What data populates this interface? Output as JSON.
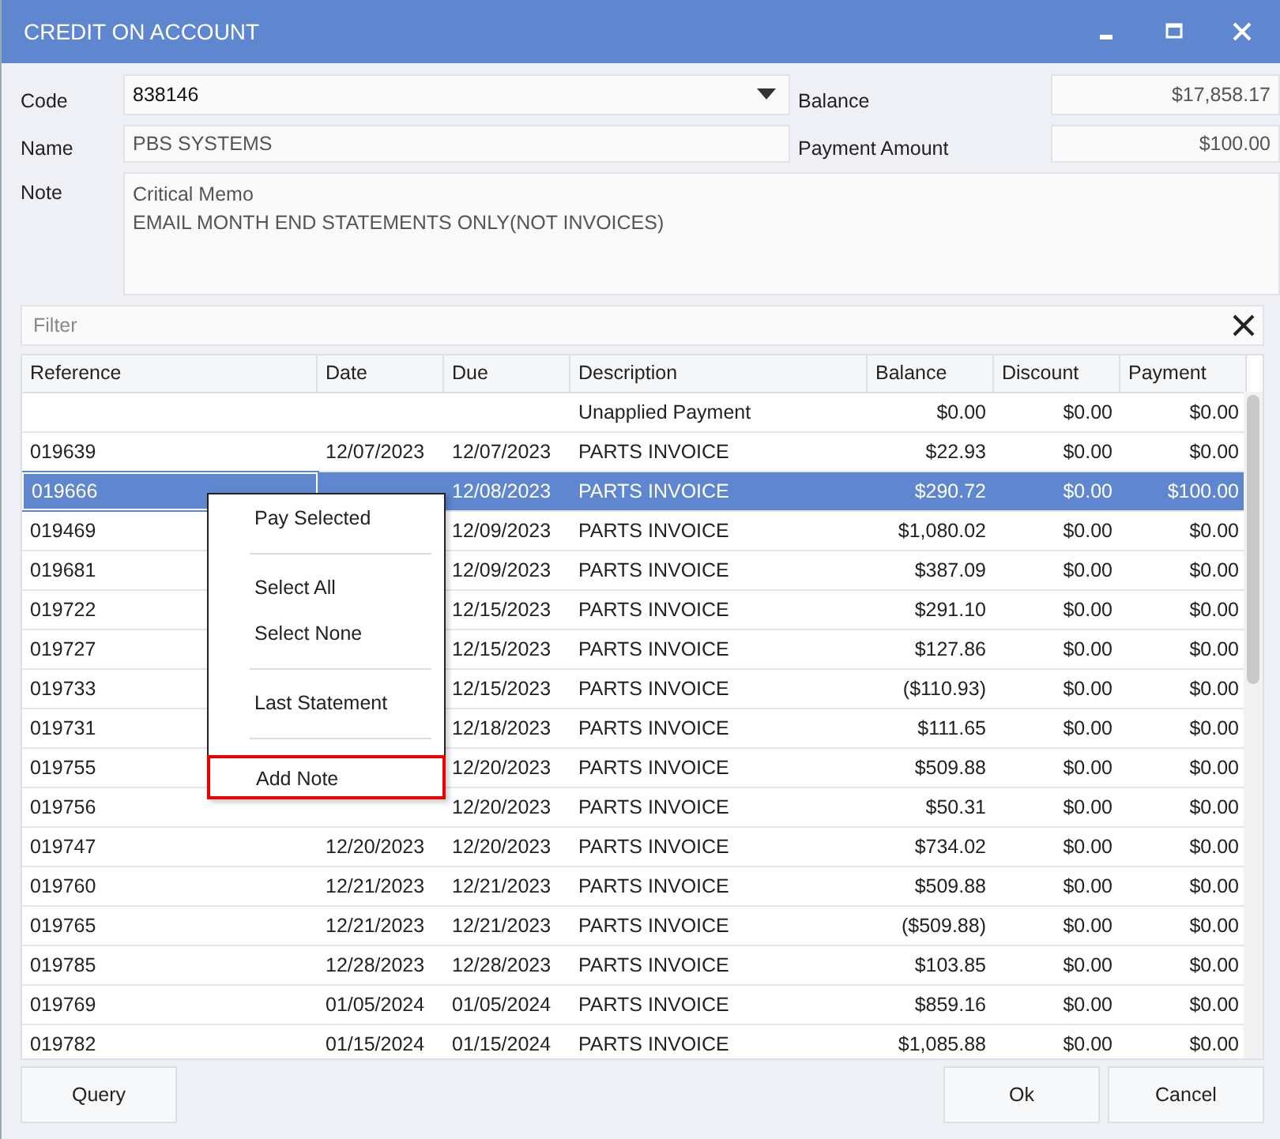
{
  "window": {
    "title": "CREDIT ON ACCOUNT"
  },
  "form": {
    "code_label": "Code",
    "code": "838146",
    "name_label": "Name",
    "name": "PBS SYSTEMS",
    "note_label": "Note",
    "note_lines": [
      "Critical Memo",
      "EMAIL MONTH END STATEMENTS ONLY(NOT INVOICES)"
    ],
    "balance_label": "Balance",
    "balance": "$17,858.17",
    "payment_label": "Payment Amount",
    "payment": "$100.00"
  },
  "filter": {
    "placeholder": "Filter"
  },
  "table": {
    "columns": [
      "Reference",
      "Date",
      "Due",
      "Description",
      "Balance",
      "Discount",
      "Payment"
    ],
    "rows": [
      {
        "reference": "",
        "date": "",
        "due": "",
        "description": "Unapplied Payment",
        "balance": "$0.00",
        "discount": "$0.00",
        "payment": "$0.00",
        "selected": false
      },
      {
        "reference": "019639",
        "date": "12/07/2023",
        "due": "12/07/2023",
        "description": "PARTS INVOICE",
        "balance": "$22.93",
        "discount": "$0.00",
        "payment": "$0.00",
        "selected": false
      },
      {
        "reference": "019666",
        "due": "12/08/2023",
        "description": "PARTS INVOICE",
        "balance": "$290.72",
        "discount": "$0.00",
        "payment": "$100.00",
        "selected": true
      },
      {
        "reference": "019469",
        "due": "12/09/2023",
        "description": "PARTS INVOICE",
        "balance": "$1,080.02",
        "discount": "$0.00",
        "payment": "$0.00",
        "selected": false
      },
      {
        "reference": "019681",
        "due": "12/09/2023",
        "description": "PARTS INVOICE",
        "balance": "$387.09",
        "discount": "$0.00",
        "payment": "$0.00",
        "selected": false
      },
      {
        "reference": "019722",
        "due": "12/15/2023",
        "description": "PARTS INVOICE",
        "balance": "$291.10",
        "discount": "$0.00",
        "payment": "$0.00",
        "selected": false
      },
      {
        "reference": "019727",
        "due": "12/15/2023",
        "description": "PARTS INVOICE",
        "balance": "$127.86",
        "discount": "$0.00",
        "payment": "$0.00",
        "selected": false
      },
      {
        "reference": "019733",
        "due": "12/15/2023",
        "description": "PARTS INVOICE",
        "balance": "($110.93)",
        "discount": "$0.00",
        "payment": "$0.00",
        "selected": false
      },
      {
        "reference": "019731",
        "due": "12/18/2023",
        "description": "PARTS INVOICE",
        "balance": "$111.65",
        "discount": "$0.00",
        "payment": "$0.00",
        "selected": false
      },
      {
        "reference": "019755",
        "due": "12/20/2023",
        "description": "PARTS INVOICE",
        "balance": "$509.88",
        "discount": "$0.00",
        "payment": "$0.00",
        "selected": false
      },
      {
        "reference": "019756",
        "due": "12/20/2023",
        "description": "PARTS INVOICE",
        "balance": "$50.31",
        "discount": "$0.00",
        "payment": "$0.00",
        "selected": false
      },
      {
        "reference": "019747",
        "date": "12/20/2023",
        "due": "12/20/2023",
        "description": "PARTS INVOICE",
        "balance": "$734.02",
        "discount": "$0.00",
        "payment": "$0.00",
        "selected": false
      },
      {
        "reference": "019760",
        "date": "12/21/2023",
        "due": "12/21/2023",
        "description": "PARTS INVOICE",
        "balance": "$509.88",
        "discount": "$0.00",
        "payment": "$0.00",
        "selected": false
      },
      {
        "reference": "019765",
        "date": "12/21/2023",
        "due": "12/21/2023",
        "description": "PARTS INVOICE",
        "balance": "($509.88)",
        "discount": "$0.00",
        "payment": "$0.00",
        "selected": false
      },
      {
        "reference": "019785",
        "date": "12/28/2023",
        "due": "12/28/2023",
        "description": "PARTS INVOICE",
        "balance": "$103.85",
        "discount": "$0.00",
        "payment": "$0.00",
        "selected": false
      },
      {
        "reference": "019769",
        "date": "01/05/2024",
        "due": "01/05/2024",
        "description": "PARTS INVOICE",
        "balance": "$859.16",
        "discount": "$0.00",
        "payment": "$0.00",
        "selected": false
      },
      {
        "reference": "019782",
        "date": "01/15/2024",
        "due": "01/15/2024",
        "description": "PARTS INVOICE",
        "balance": "$1,085.88",
        "discount": "$0.00",
        "payment": "$0.00",
        "selected": false
      }
    ]
  },
  "context_menu": {
    "groups": [
      [
        {
          "label": "Pay Selected",
          "highlighted": false
        }
      ],
      [
        {
          "label": "Select All",
          "highlighted": false
        },
        {
          "label": "Select None",
          "highlighted": false
        }
      ],
      [
        {
          "label": "Last Statement",
          "highlighted": false
        }
      ],
      [
        {
          "label": "Add Note",
          "highlighted": true
        }
      ]
    ]
  },
  "buttons": {
    "left": [
      "Query"
    ],
    "right": [
      "Ok",
      "Cancel"
    ]
  }
}
